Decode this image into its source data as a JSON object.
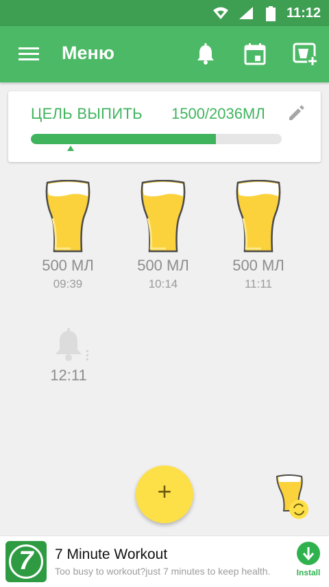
{
  "status_bar": {
    "time": "11:12"
  },
  "toolbar": {
    "title": "Меню",
    "menu_icon": "hamburger-icon",
    "bell_icon": "bell-icon",
    "calendar_icon": "calendar-icon",
    "add_cup_icon": "add-cup-icon"
  },
  "goal": {
    "label": "ЦЕЛЬ ВЫПИТЬ",
    "value": "1500/2036МЛ",
    "progress_fraction": 0.737,
    "accent": "#3fb45d"
  },
  "records": [
    {
      "amount": "500 МЛ",
      "time": "09:39"
    },
    {
      "amount": "500 МЛ",
      "time": "10:14"
    },
    {
      "amount": "500 МЛ",
      "time": "11:11"
    }
  ],
  "reminder": {
    "time": "12:11"
  },
  "fab": {
    "label": "+"
  },
  "ad": {
    "logo_text": "7",
    "title": "7 Minute Workout",
    "subtitle": "Too busy to workout?just 7 minutes to keep health.",
    "install_label": "Install"
  }
}
